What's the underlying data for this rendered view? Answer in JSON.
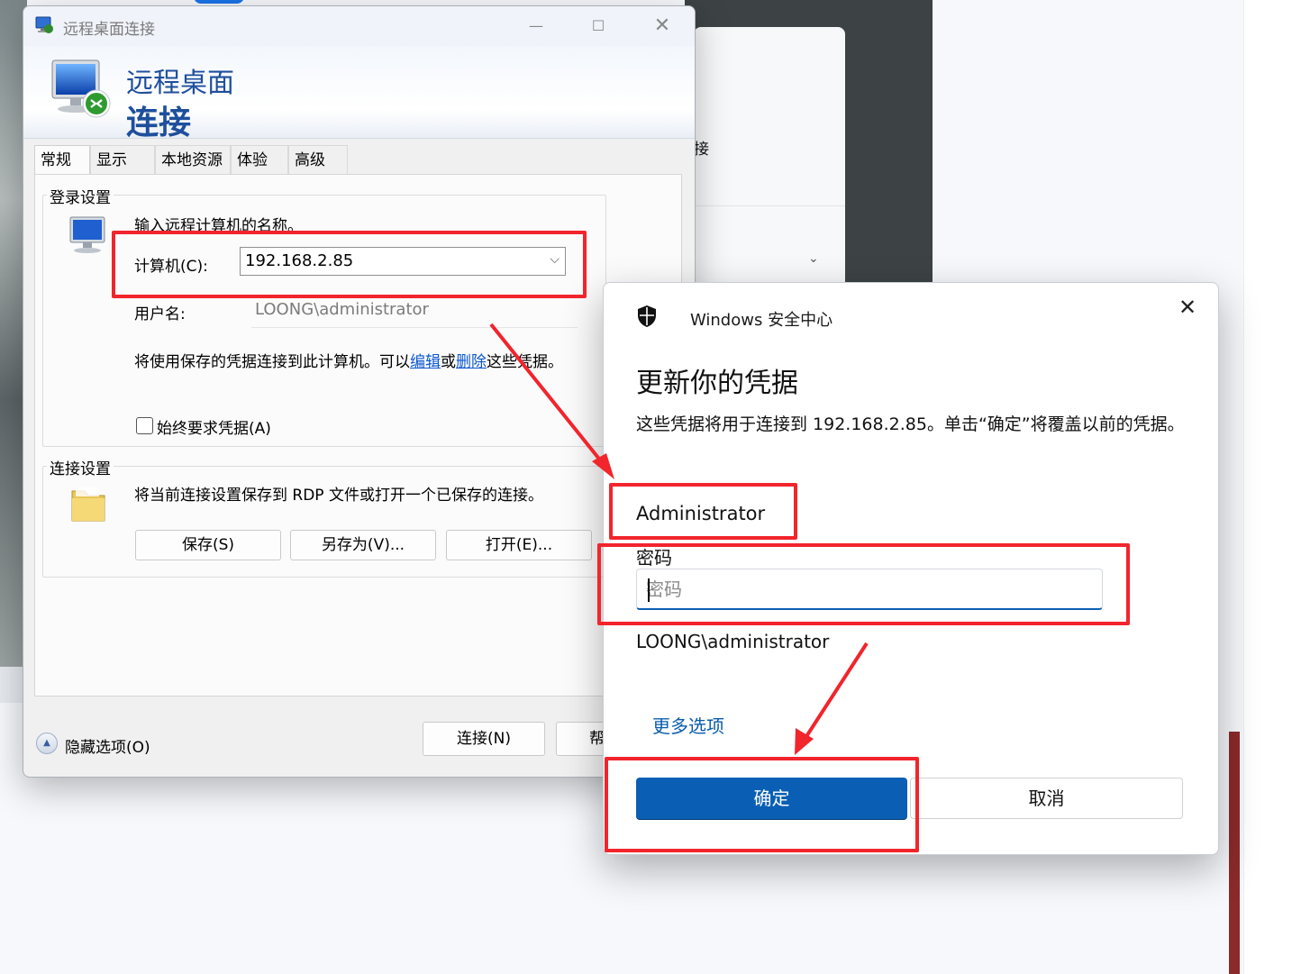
{
  "rdp": {
    "title": "远程桌面连接",
    "banner_line1": "远程桌面",
    "banner_line2": "连接",
    "tabs": [
      "常规",
      "显示",
      "本地资源",
      "体验",
      "高级"
    ],
    "login": {
      "group_label": "登录设置",
      "prompt": "输入远程计算机的名称。",
      "computer_label": "计算机(C):",
      "computer_value": "192.168.2.85",
      "username_label": "用户名:",
      "username_value": "LOONG\\administrator",
      "saved_prefix": "将使用保存的凭据连接到此计算机。可以",
      "edit_link": "编辑",
      "or": "或",
      "delete_link": "删除",
      "saved_suffix": "这些凭据。",
      "always_ask": "始终要求凭据(A)"
    },
    "connection": {
      "group_label": "连接设置",
      "desc": "将当前连接设置保存到 RDP 文件或打开一个已保存的连接。",
      "save_btn": "保存(S)",
      "save_as_btn": "另存为(V)...",
      "open_btn": "打开(E)..."
    },
    "footer": {
      "hide_options": "隐藏选项(O)",
      "connect_btn": "连接(N)",
      "help_btn": "帮"
    }
  },
  "security": {
    "app_name": "Windows 安全中心",
    "heading": "更新你的凭据",
    "description": "这些凭据将用于连接到 192.168.2.85。单击“确定”将覆盖以前的凭据。",
    "username": "Administrator",
    "password_label": "密码",
    "password_placeholder": "密码",
    "domain_user": "LOONG\\administrator",
    "more_options": "更多选项",
    "ok_btn": "确定",
    "cancel_btn": "取消"
  },
  "background": {
    "partial_text": "接"
  },
  "colors": {
    "accent": "#0a5fb4",
    "highlight_red": "#f2242c",
    "rdp_banner_blue": "#1e4f9c",
    "link_blue": "#0b57d0"
  },
  "icons": [
    "rdp-computer-icon",
    "rdp-computer-small-icon",
    "folder-icon",
    "shield-icon",
    "close-icon",
    "minimize-icon",
    "maximize-icon",
    "chevron-down-icon",
    "collapse-up-icon"
  ]
}
